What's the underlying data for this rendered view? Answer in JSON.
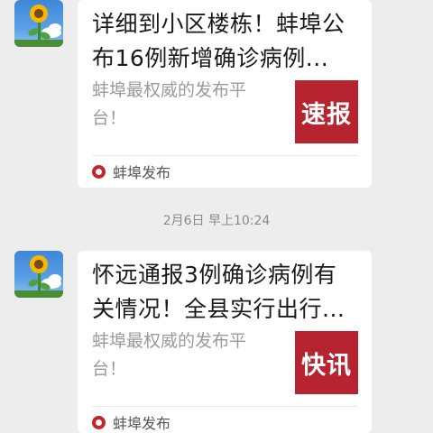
{
  "messages": [
    {
      "title": "详细到小区楼栋！蚌埠公\n布16例新增确诊病例...",
      "description": "蚌埠最权威的发布平\n台！",
      "thumb_text": "速报",
      "source": "蚌埠发布"
    },
    {
      "title": "怀远通报3例确诊病例有\n关情况！全县实行出行...",
      "description": "蚌埠最权威的发布平\n台！",
      "thumb_text": "快讯",
      "source": "蚌埠发布"
    }
  ],
  "timestamp": "2月6日 早上10:24",
  "colors": {
    "background": "#ededed",
    "thumb": "#b7232f",
    "source_icon": "#c0272d"
  }
}
